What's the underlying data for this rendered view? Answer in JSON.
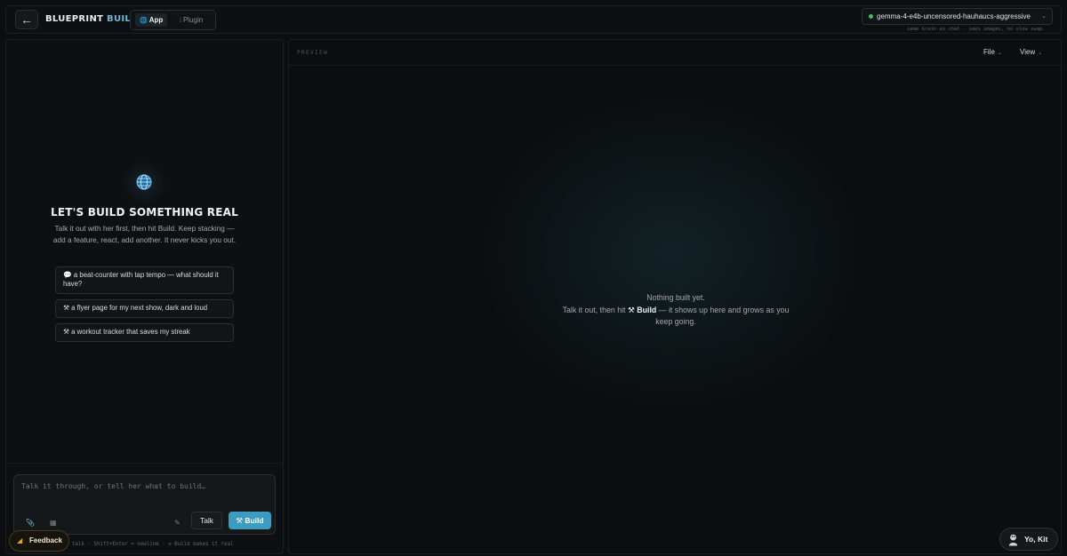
{
  "header": {
    "back_icon": "arrow-left-icon",
    "brand_main": "BLUEPRINT",
    "brand_accent": "BUILDS",
    "tabs": [
      {
        "label": "App",
        "icon": "globe-icon",
        "active": true
      },
      {
        "label": "Plugin",
        "icon": "plugin-icon",
        "active": false
      }
    ],
    "model": "gemma-4-e4b-uncensored-hauhaucs-aggressive",
    "model_status_color": "#3fbf62",
    "model_note": "same brain as chat · sees images, no slow swap"
  },
  "chat": {
    "empty_title": "LET'S BUILD SOMETHING REAL",
    "empty_desc": "Talk it out with her first, then hit Build. Keep stacking — add a feature, react, add another. It never kicks you out.",
    "suggestions": [
      "💬 a beat-counter with tap tempo — what should it have?",
      "⚒ a flyer page for my next show, dark and loud",
      "⚒ a workout tracker that saves my streak"
    ],
    "composer": {
      "placeholder": "Talk it through, or tell her what to build…",
      "talk_label": "Talk",
      "build_label": "⚒ Build",
      "hint": "talk · Shift+Enter = newline · ⚒ Build makes it real"
    }
  },
  "preview": {
    "label": "PREVIEW",
    "menus": [
      "File",
      "View"
    ],
    "empty_line1": "Nothing built yet.",
    "empty_line2_pre": "Talk it out, then hit",
    "empty_line2_bold": "⚒ Build",
    "empty_line2_post": "— it shows up here and grows as you keep going."
  },
  "floating": {
    "feedback_label": "Feedback",
    "user_label": "Yo, Kit"
  },
  "colors": {
    "accent": "#3b9cc0",
    "brand_accent": "#6fb6d6",
    "background": "#0b0d0f"
  }
}
